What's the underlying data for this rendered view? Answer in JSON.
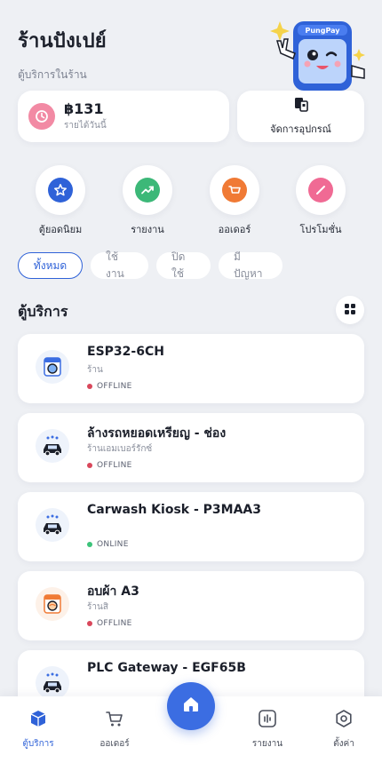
{
  "header": {
    "title": "ร้านปังเปย์",
    "subtitle": "ตู้บริการในร้าน"
  },
  "mascot": {
    "brand_label": "PungPay"
  },
  "summary": {
    "revenue_amount": "฿131",
    "revenue_label": "รายได้วันนี้",
    "devices_label": "จัดการอุปกรณ์"
  },
  "quick_actions": [
    {
      "label": "ตู้ยอดนิยม",
      "icon": "star-icon",
      "color": "#2f62d8"
    },
    {
      "label": "รายงาน",
      "icon": "trend-up-icon",
      "color": "#3cb878"
    },
    {
      "label": "ออเดอร์",
      "icon": "basket-icon",
      "color": "#f07a35"
    },
    {
      "label": "โปรโมชั่น",
      "icon": "pencil-icon",
      "color": "#f06a94"
    }
  ],
  "filters": [
    {
      "label": "ทั้งหมด",
      "active": true
    },
    {
      "label": "ใช้งาน",
      "active": false
    },
    {
      "label": "ปิดใช้",
      "active": false
    },
    {
      "label": "มีปัญหา",
      "active": false
    }
  ],
  "section": {
    "title": "ตู้บริการ"
  },
  "devices": [
    {
      "name": "ESP32-6CH",
      "sub": "ร้าน",
      "status": "OFFLINE",
      "status_color": "#d9475b",
      "icon": "washing-machine-icon"
    },
    {
      "name": "ล้างรถหยอดเหรียญ - ช่อง",
      "sub": "ร้านเอมเบอร์รักซ์",
      "status": "OFFLINE",
      "status_color": "#d9475b",
      "icon": "car-wash-icon"
    },
    {
      "name": "Carwash Kiosk - P3MAA3",
      "sub": "",
      "status": "ONLINE",
      "status_color": "#3cc37a",
      "icon": "car-wash-icon"
    },
    {
      "name": "อบผ้า A3",
      "sub": "ร้านสิ",
      "status": "OFFLINE",
      "status_color": "#d9475b",
      "icon": "dryer-icon"
    },
    {
      "name": "PLC Gateway - EGF65B",
      "sub": "",
      "status": "",
      "status_color": "#d9475b",
      "icon": "car-wash-icon"
    }
  ],
  "nav": {
    "machines": "ตู้บริการ",
    "orders": "ออเดอร์",
    "reports": "รายงาน",
    "settings": "ตั้งค่า"
  },
  "colors": {
    "accent": "#2f62d8",
    "background": "#eef0f4",
    "online": "#3cc37a",
    "offline": "#d9475b"
  }
}
